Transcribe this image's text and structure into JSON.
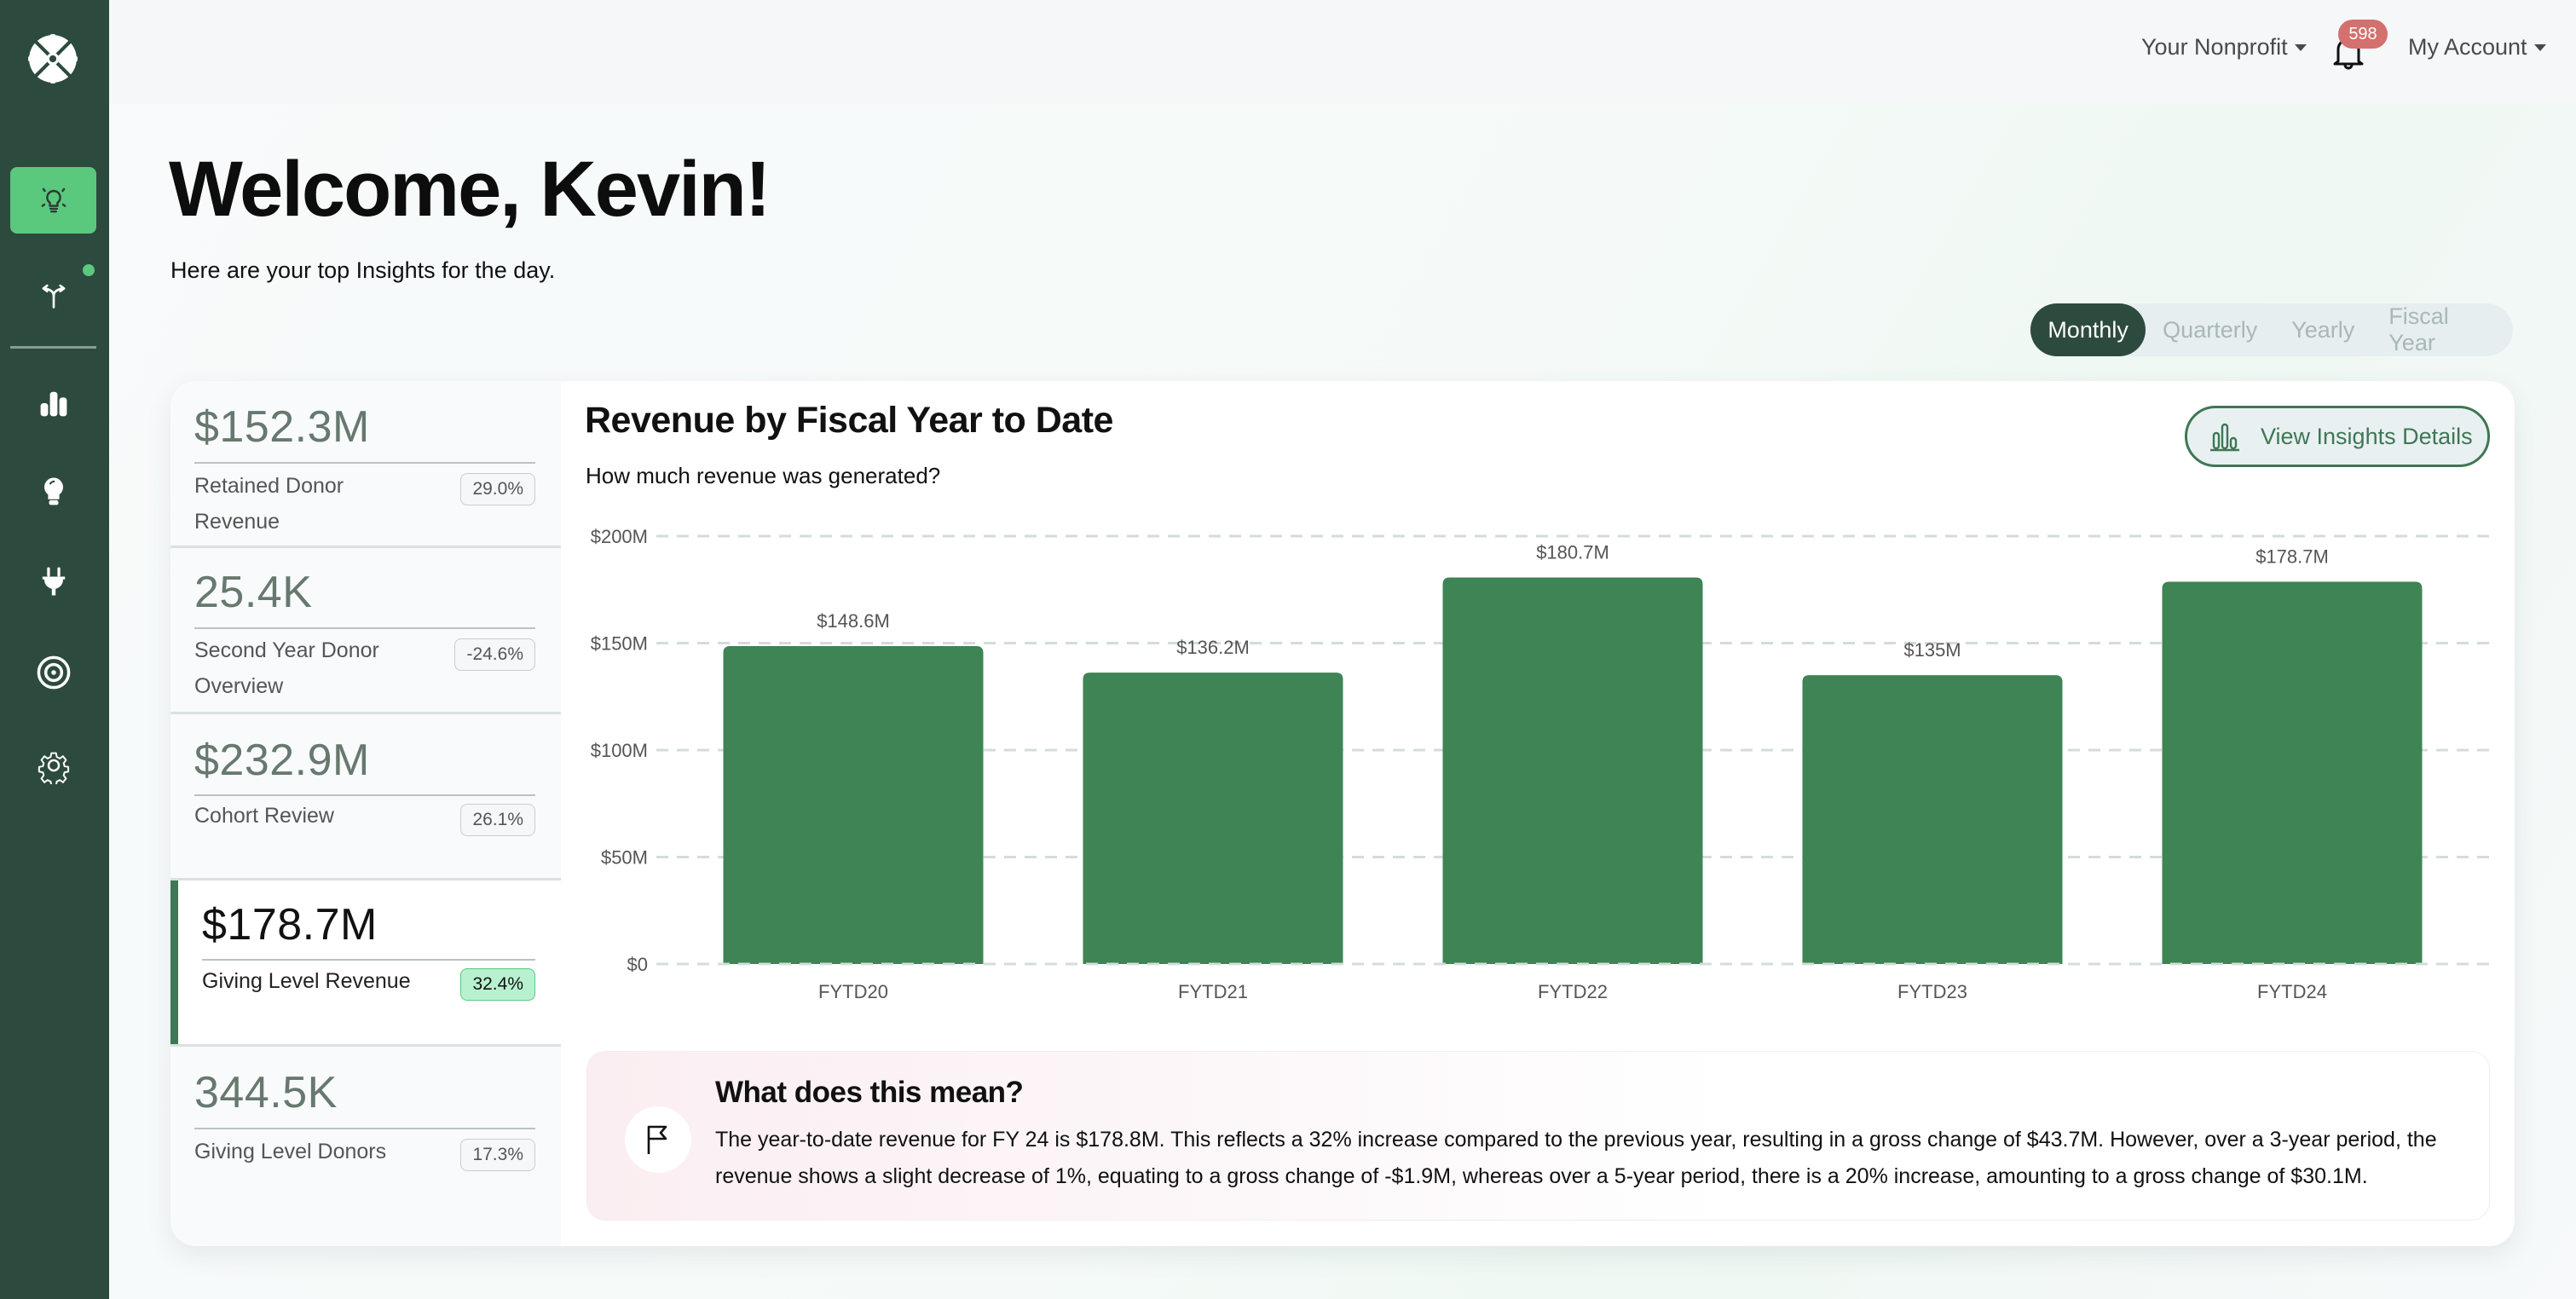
{
  "sidebar": {
    "logo": "snowflake-logo-icon",
    "items": [
      {
        "icon": "lightbulb-outline-icon",
        "active": true
      },
      {
        "icon": "split-arrows-icon",
        "active": false,
        "has_notification_dot": true
      },
      {
        "icon": "bar-chart-icon",
        "active": false
      },
      {
        "icon": "lightbulb-filled-icon",
        "active": false
      },
      {
        "icon": "plug-icon",
        "active": false
      },
      {
        "icon": "target-icon",
        "active": false
      },
      {
        "icon": "gear-icon",
        "active": false
      }
    ]
  },
  "header": {
    "org_menu": "Your Nonprofit",
    "notification_count": "598",
    "account_menu": "My Account"
  },
  "welcome": {
    "title": "Welcome, Kevin!",
    "subtitle": "Here are your top Insights for the day."
  },
  "period_toggle": {
    "options": [
      "Monthly",
      "Quarterly",
      "Yearly",
      "Fiscal Year"
    ],
    "selected": "Monthly"
  },
  "kpis": [
    {
      "value": "$152.3M",
      "label": "Retained Donor Revenue",
      "change": "29.0%",
      "active": false
    },
    {
      "value": "25.4K",
      "label": "Second Year Donor Overview",
      "change": "-24.6%",
      "active": false
    },
    {
      "value": "$232.9M",
      "label": "Cohort Review",
      "change": "26.1%",
      "active": false
    },
    {
      "value": "$178.7M",
      "label": "Giving Level Revenue",
      "change": "32.4%",
      "active": true
    },
    {
      "value": "344.5K",
      "label": "Giving Level Donors",
      "change": "17.3%",
      "active": false
    }
  ],
  "panel": {
    "title": "Revenue by Fiscal Year to Date",
    "subtitle": "How much revenue was generated?",
    "details_button": "View Insights Details"
  },
  "chart_data": {
    "type": "bar",
    "title": "Revenue by Fiscal Year to Date",
    "xlabel": "",
    "ylabel": "",
    "categories": [
      "FYTD20",
      "FYTD21",
      "FYTD22",
      "FYTD23",
      "FYTD24"
    ],
    "values": [
      148.6,
      136.2,
      180.7,
      135,
      178.7
    ],
    "value_labels": [
      "$148.6M",
      "$136.2M",
      "$180.7M",
      "$135M",
      "$178.7M"
    ],
    "units": "$M",
    "ylim": [
      0,
      200
    ],
    "yticks": [
      0,
      50,
      100,
      150,
      200
    ],
    "ytick_labels": [
      "$0",
      "$50M",
      "$100M",
      "$150M",
      "$200M"
    ],
    "grid": true,
    "grid_style": "dashed",
    "bar_color": "#3e8454"
  },
  "insight": {
    "title": "What does this mean?",
    "icon": "flag-icon",
    "text": "The year-to-date revenue for FY 24 is $178.8M. This reflects a 32% increase compared to the previous year, resulting in a gross change of $43.7M. However, over a 3-year period, the revenue shows a slight decrease of 1%, equating to a gross change of -$1.9M, whereas over a 5-year period, there is a 20% increase, amounting to a gross change of $30.1M."
  },
  "colors": {
    "sidebar_bg": "#2d4a3e",
    "accent_green": "#5ac87d",
    "bar_green": "#3e8454",
    "badge_red": "#d4706e",
    "positive_badge_bg": "#b8f1cf"
  }
}
